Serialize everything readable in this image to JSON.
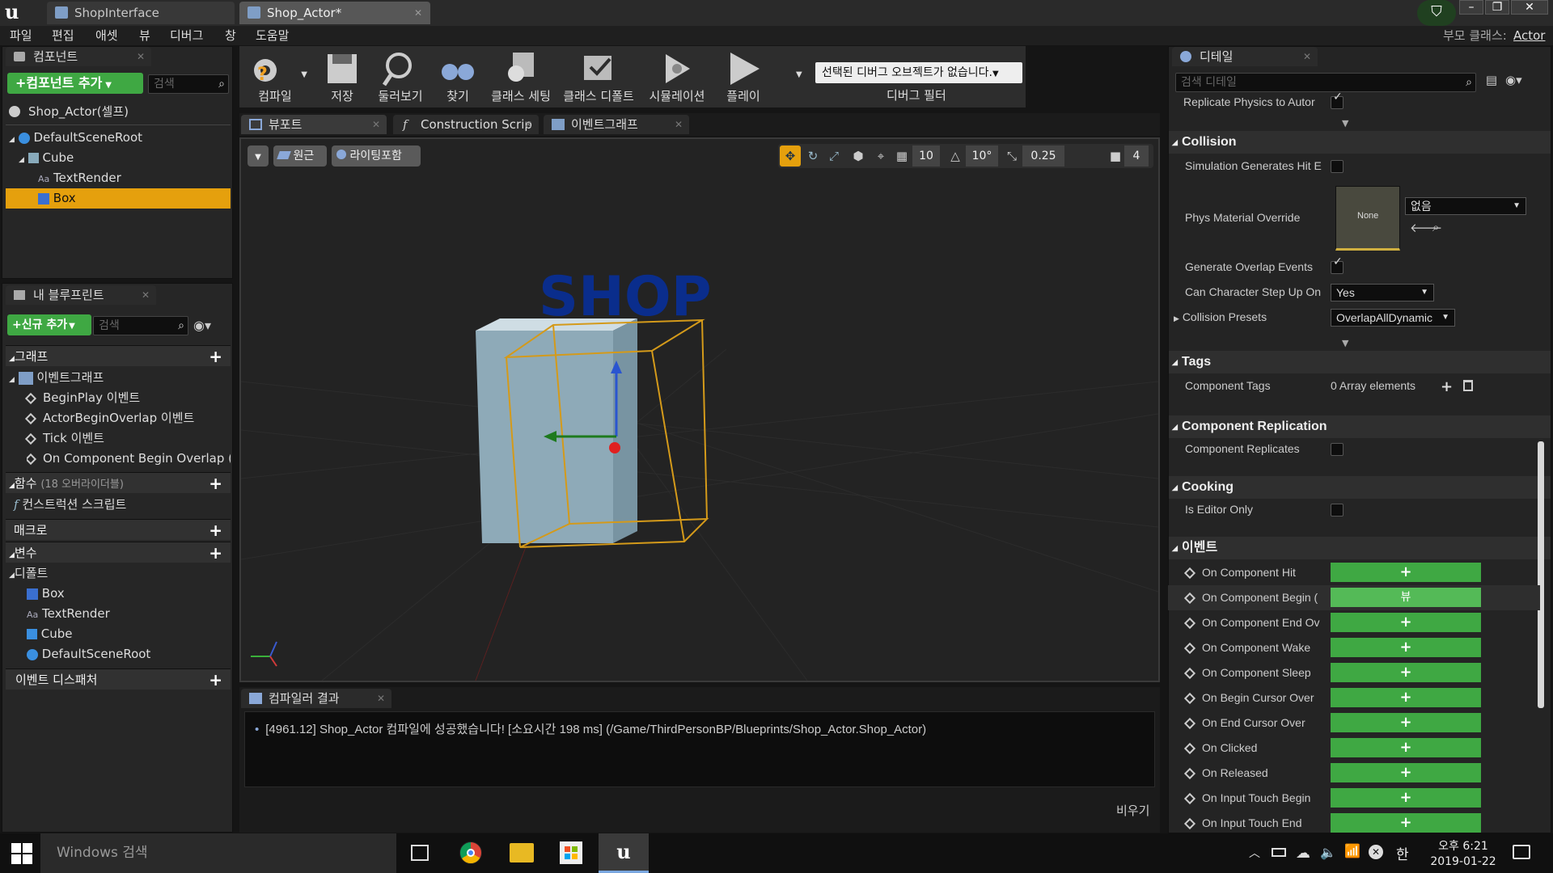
{
  "title_tabs": [
    "ShopInterface",
    "Shop_Actor*"
  ],
  "menu": [
    "파일",
    "편집",
    "애셋",
    "뷰",
    "디버그",
    "창",
    "도움말"
  ],
  "parent_class_label": "부모 클래스:",
  "parent_class_value": "Actor",
  "components_panel": {
    "tab": "컴포넌트",
    "add_button": "+컴포넌트 추가",
    "search_placeholder": "검색",
    "root_label": "Shop_Actor(셀프)",
    "tree": [
      "DefaultSceneRoot",
      "Cube",
      "TextRender",
      "Box"
    ]
  },
  "blueprint_panel": {
    "tab": "내 블루프린트",
    "add_button": "+신규 추가",
    "search_placeholder": "검색",
    "graph_section": "그래프",
    "event_graph": "이벤트그래프",
    "events": [
      "BeginPlay 이벤트",
      "ActorBeginOverlap 이벤트",
      "Tick 이벤트",
      "On Component Begin Overlap ("
    ],
    "functions_section": "함수",
    "functions_note": "(18 오버라이더블)",
    "construction_script": "컨스트럭션 스크립트",
    "macros_section": "매크로",
    "variables_section": "변수",
    "defaults_label": "디폴트",
    "variables": [
      "Box",
      "TextRender",
      "Cube",
      "DefaultSceneRoot"
    ],
    "dispatchers_section": "이벤트 디스패처"
  },
  "toolbar": {
    "compile": "컴파일",
    "save": "저장",
    "browse": "둘러보기",
    "find": "찾기",
    "class_settings": "클래스 세팅",
    "class_defaults": "클래스 디폴트",
    "simulation": "시뮬레이션",
    "play": "플레이",
    "debug_object": "선택된 디버그 오브젝트가 없습니다.",
    "debug_filter": "디버그 필터"
  },
  "editor_tabs": [
    "뷰포트",
    "Construction Scrip",
    "이벤트그래프"
  ],
  "viewport": {
    "perspective": "원근",
    "lighting": "라이팅포함",
    "grid_snap": "10",
    "rot_snap": "10°",
    "scale_snap": "0.25",
    "cam_speed": "4",
    "text_render": "SHOP"
  },
  "compiler": {
    "tab": "컴파일러 결과",
    "message": "[4961.12] Shop_Actor 컴파일에 성공했습니다! [소요시간 198 ms] (/Game/ThirdPersonBP/Blueprints/Shop_Actor.Shop_Actor)",
    "clear": "비우기"
  },
  "details": {
    "tab": "디테일",
    "search_placeholder": "검색 디테일",
    "replicate_physics": "Replicate Physics to Autor",
    "collision_section": "Collision",
    "sim_hit": "Simulation Generates Hit E",
    "phys_material": "Phys Material Override",
    "phys_thumb": "None",
    "phys_value": "없음",
    "overlap_events": "Generate Overlap Events",
    "step_up": "Can Character Step Up On",
    "step_up_value": "Yes",
    "presets": "Collision Presets",
    "presets_value": "OverlapAllDynamic",
    "tags_section": "Tags",
    "component_tags": "Component Tags",
    "array_elements": "0 Array elements",
    "replication_section": "Component Replication",
    "component_replicates": "Component Replicates",
    "cooking_section": "Cooking",
    "editor_only": "Is Editor Only",
    "events_section": "이벤트",
    "events": [
      {
        "label": "On Component Hit",
        "btn": "+"
      },
      {
        "label": "On Component Begin (",
        "btn": "뷰"
      },
      {
        "label": "On Component End Ov",
        "btn": "+"
      },
      {
        "label": "On Component Wake",
        "btn": "+"
      },
      {
        "label": "On Component Sleep",
        "btn": "+"
      },
      {
        "label": "On Begin Cursor Over",
        "btn": "+"
      },
      {
        "label": "On End Cursor Over",
        "btn": "+"
      },
      {
        "label": "On Clicked",
        "btn": "+"
      },
      {
        "label": "On Released",
        "btn": "+"
      },
      {
        "label": "On Input Touch Begin",
        "btn": "+"
      },
      {
        "label": "On Input Touch End",
        "btn": "+"
      }
    ]
  },
  "taskbar": {
    "search": "Windows 검색",
    "ime": "한",
    "time": "오후 6:21",
    "date": "2019-01-22"
  },
  "colors": {
    "accent_green": "#3fa843",
    "selection": "#e5a00d",
    "bg_dark": "#151515"
  }
}
